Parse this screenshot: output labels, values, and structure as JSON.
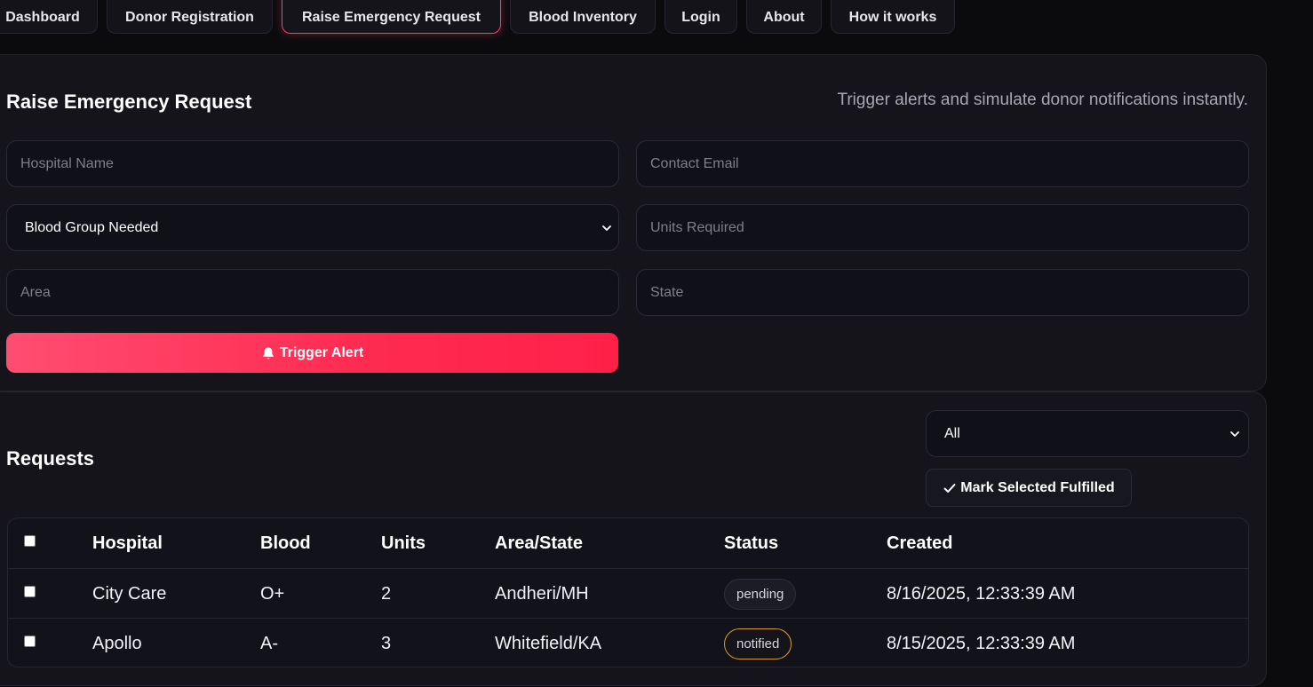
{
  "nav": {
    "tabs": [
      {
        "label": "Dashboard"
      },
      {
        "label": "Donor Registration"
      },
      {
        "label": "Raise Emergency Request"
      },
      {
        "label": "Blood Inventory"
      },
      {
        "label": "Login"
      },
      {
        "label": "About"
      },
      {
        "label": "How it works"
      }
    ],
    "active": "Raise Emergency Request"
  },
  "form": {
    "title": "Raise Emergency Request",
    "subtitle": "Trigger alerts and simulate donor notifications instantly.",
    "hospital_placeholder": "Hospital Name",
    "email_placeholder": "Contact Email",
    "blood_group_selected": "Blood Group Needed",
    "units_placeholder": "Units Required",
    "area_placeholder": "Area",
    "state_placeholder": "State",
    "trigger_label": "Trigger Alert"
  },
  "requests": {
    "title": "Requests",
    "filter_selected": "All",
    "mark_label": "Mark Selected Fulfilled",
    "columns": [
      "Hospital",
      "Blood",
      "Units",
      "Area/State",
      "Status",
      "Created"
    ],
    "rows": [
      {
        "hospital": "City Care",
        "blood": "O+",
        "units": "2",
        "area_state": "Andheri/MH",
        "status": "pending",
        "created": "8/16/2025, 12:33:39 AM"
      },
      {
        "hospital": "Apollo",
        "blood": "A-",
        "units": "3",
        "area_state": "Whitefield/KA",
        "status": "notified",
        "created": "8/15/2025, 12:33:39 AM"
      }
    ]
  },
  "colors": {
    "accent": "#ff2a50",
    "pending_border": "#2e2e3a",
    "notified_border": "#d99a2b"
  }
}
